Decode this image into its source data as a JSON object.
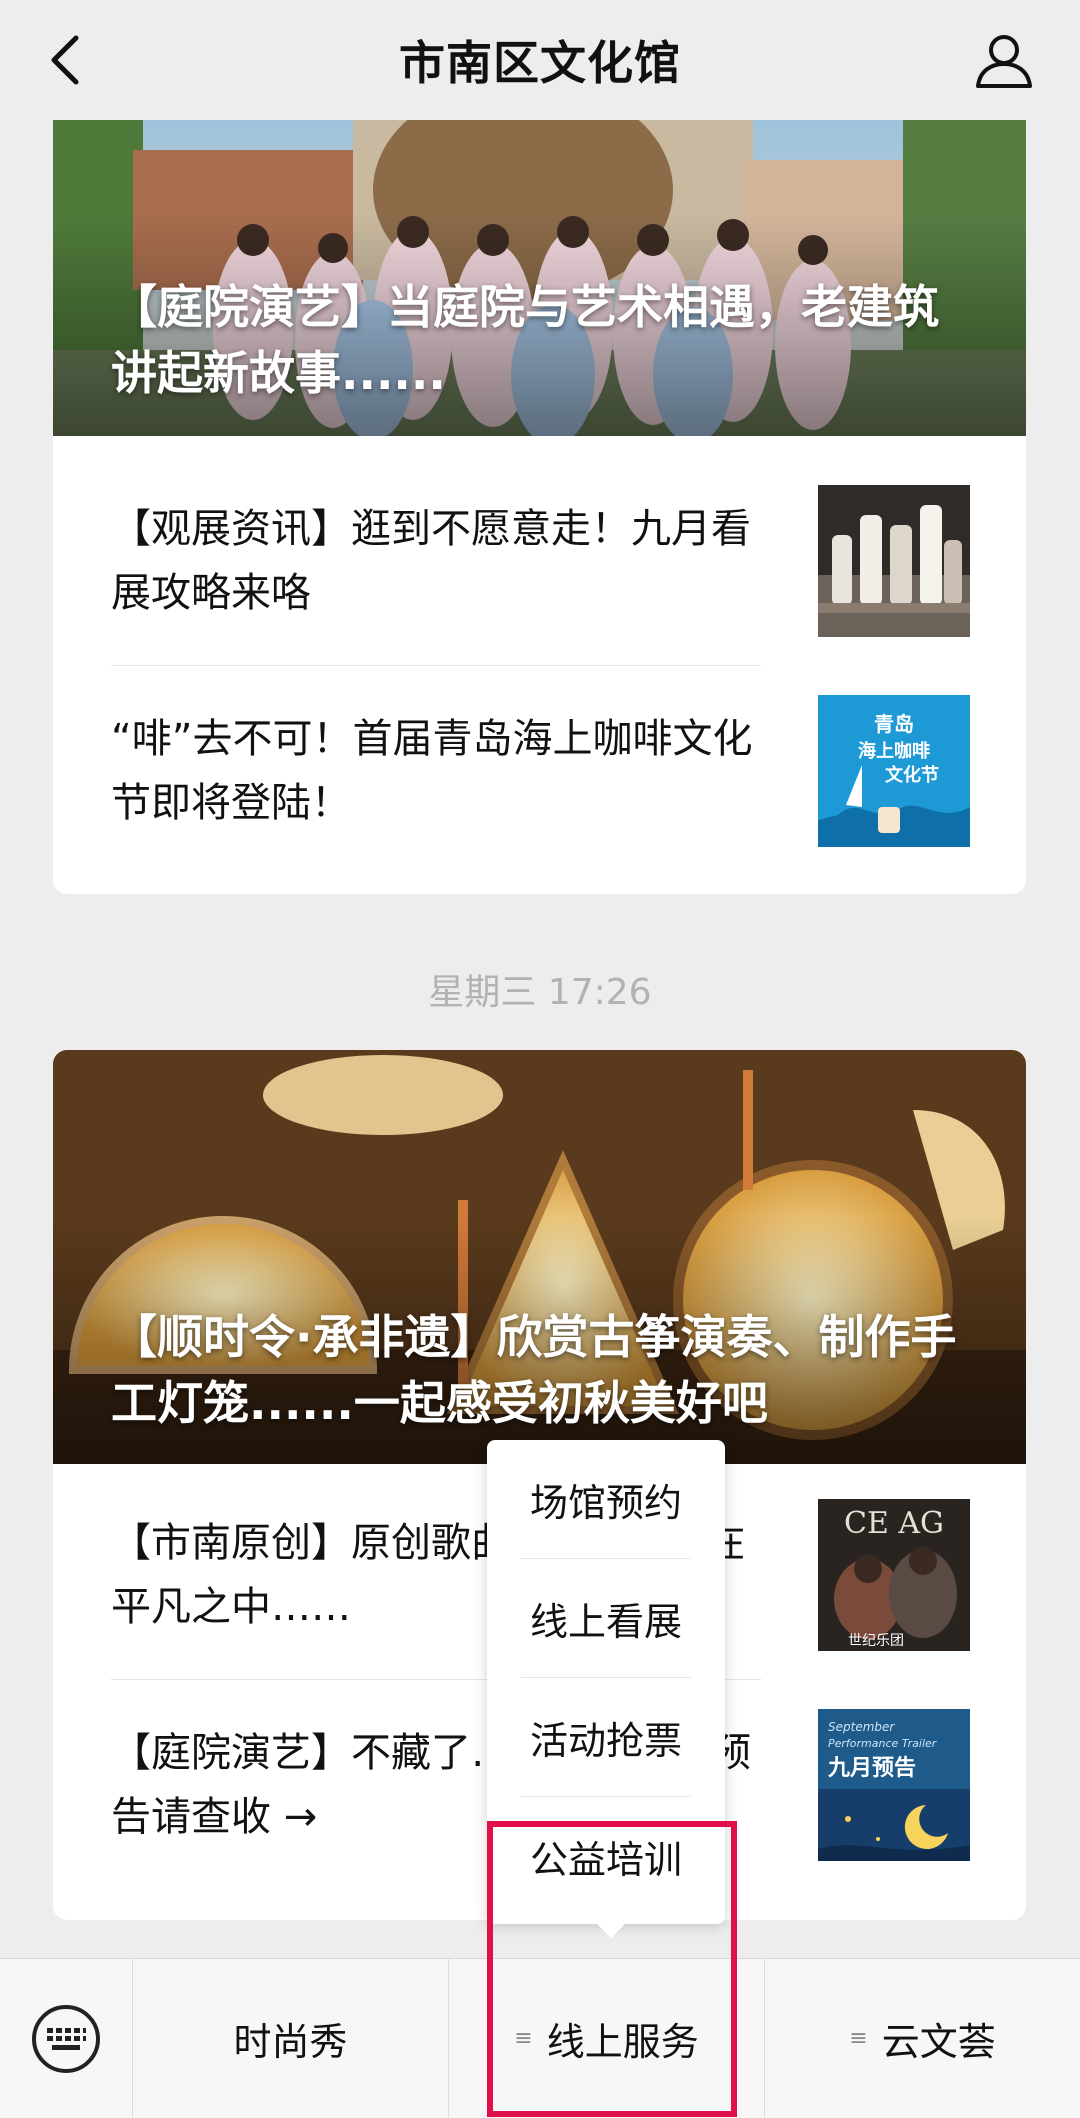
{
  "header": {
    "title": "市南区文化馆"
  },
  "feed": {
    "card1": {
      "hero_title": "【庭院演艺】当庭院与艺术相遇，老建筑讲起新故事......",
      "items": [
        {
          "title": "【观展资讯】逛到不愿意走！九月看展攻略来咯"
        },
        {
          "title": "“啡”去不可！首届青岛海上咖啡文化节即将登陆！",
          "thumb_text": [
            "青岛",
            "海上咖啡",
            "文化节"
          ]
        }
      ]
    },
    "timestamp": "星期三 17:26",
    "card2": {
      "hero_title": "【顺时令·承非遗】欣赏古筝演奏、制作手工灯笼......一起感受初秋美好吧",
      "items": [
        {
          "title": "【市南原创】原创歌曲《Love》：在平凡之中……",
          "thumb_text": [
            "CE AG",
            "世纪乐团"
          ]
        },
        {
          "title": "【庭院演艺】不藏了……九月演出预告请查收 →",
          "thumb_text": [
            "September",
            "Performance Trailer",
            "九月预告"
          ]
        }
      ]
    }
  },
  "popup_menu": {
    "items": [
      "场馆预约",
      "线上看展",
      "活动抢票",
      "公益培训"
    ]
  },
  "bottom_menu": {
    "tabs": [
      {
        "label": "时尚秀",
        "has_submenu": false
      },
      {
        "label": "线上服务",
        "has_submenu": true
      },
      {
        "label": "云文荟",
        "has_submenu": true
      }
    ]
  },
  "colors": {
    "highlight": "#e0104a",
    "background": "#ededed",
    "coffee_thumb_bg": "#1d9ad6"
  }
}
